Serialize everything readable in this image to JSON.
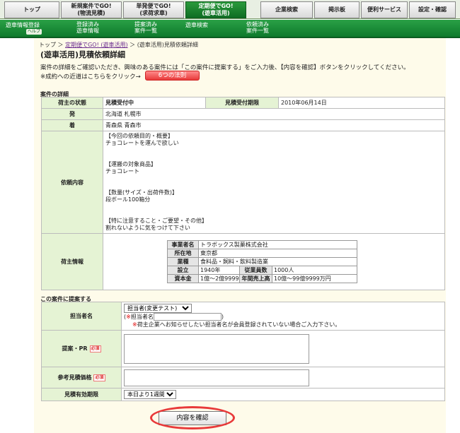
{
  "nav": {
    "tabs": [
      {
        "label": "トップ"
      },
      {
        "label": "新規案件でGO!\n(物流見積)"
      },
      {
        "label": "単発便でGO!\n(求荷求車)"
      },
      {
        "label": "定期便でGO!\n(遊車活用)"
      },
      {
        "label": "企業検索"
      },
      {
        "label": "掲示板"
      },
      {
        "label": "便利サービス"
      },
      {
        "label": "設定・確認"
      }
    ],
    "sub": [
      {
        "label": "遊車情報登録"
      },
      {
        "label": "登録済み\n遊車情報"
      },
      {
        "label": "提案済み\n案件一覧"
      },
      {
        "label": "遊車検索"
      },
      {
        "label": "依頼済み\n案件一覧"
      }
    ],
    "help_label": "ヘルプ"
  },
  "breadcrumb": {
    "home": "トップ",
    "sep": "＞",
    "link": "定期便でGO! (遊車活用)",
    "current": "(遊車活用)見積依頼詳細"
  },
  "page_title": "(遊車活用)見積依頼詳細",
  "intro": {
    "line1": "案件の詳細をご確認いただき、興味のある案件には「この案件に提案する」をご入力後、【内容を確認】ボタンをクリックしてください。",
    "line2": "※成約への近道はこちらをクリック→",
    "law_button": "6つの法則"
  },
  "detail": {
    "section_title": "案件の詳細",
    "status_label": "荷主の状態",
    "status_value": "見積受付中",
    "deadline_label": "見積受付期限",
    "deadline_value": "2010年06月14日",
    "from_label": "発",
    "from_value": "北海道 札幌市",
    "to_label": "着",
    "to_value": "青森県 青森市",
    "request_label": "依頼内容",
    "request_text": "【今回の依頼目的・概要】\nチョコレートを運んで欲しい\n\n\n【運搬の対象商品】\nチョコレート\n\n\n【数量(サイズ・出荷件数)】\n段ボール100箱分\n\n\n【特に注意すること・ご要望・その他】\n割れないように気をつけて下さい",
    "shipper_label": "荷主情報",
    "company_name_label": "事業者名",
    "company_name": "トラボックス製菓株式会社",
    "location_label": "所在地",
    "location": "東京都",
    "industry_label": "業種",
    "industry": "食料品・飼料・飲料製造業",
    "founded_label": "設立",
    "founded": "1940年",
    "employees_label": "従業員数",
    "employees": "1000人",
    "capital_label": "資本金",
    "capital": "1億〜2億9999万円",
    "sales_label": "年間売上高",
    "sales": "10億〜99億9999万円"
  },
  "proposal": {
    "section_title": "この案件に提案する",
    "person_label": "担当者名",
    "person_select": "担当者(変更テスト)",
    "person_name_prefix": "(",
    "person_name_mark": "※",
    "person_name_label": "担当者名",
    "person_name_suffix": ")",
    "person_note_mark": "※",
    "person_note": "荷主企業へお知らせしたい担当者名が会員登録されていない場合ご入力下さい。",
    "pr_label": "提案・PR",
    "price_label": "参考見積価格",
    "validity_label": "見積有効期限",
    "validity_select": "本日より1週間",
    "required": "必須"
  },
  "submit_label": "内容を確認"
}
